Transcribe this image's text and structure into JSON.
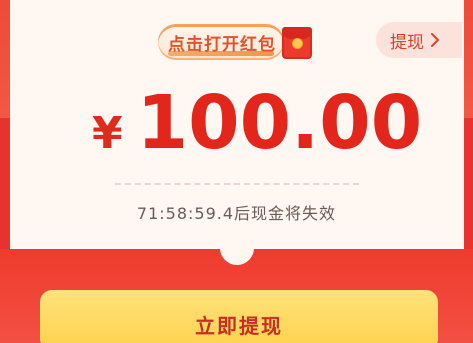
{
  "open_packet": {
    "label": "点击打开红包",
    "icon": "red-envelope-icon"
  },
  "withdraw_link": {
    "label": "提现",
    "icon": "chevron-right-icon"
  },
  "balance": {
    "currency": "¥",
    "amount": "100.00"
  },
  "countdown": {
    "text": "71:58:59.4后现金将失效"
  },
  "primary_action": {
    "label": "立即提现"
  },
  "colors": {
    "accent_red": "#e2261b",
    "panel_red": "#ef3b2e",
    "cta_yellow": "#fdd24e",
    "card_bg": "#fff7f1"
  }
}
